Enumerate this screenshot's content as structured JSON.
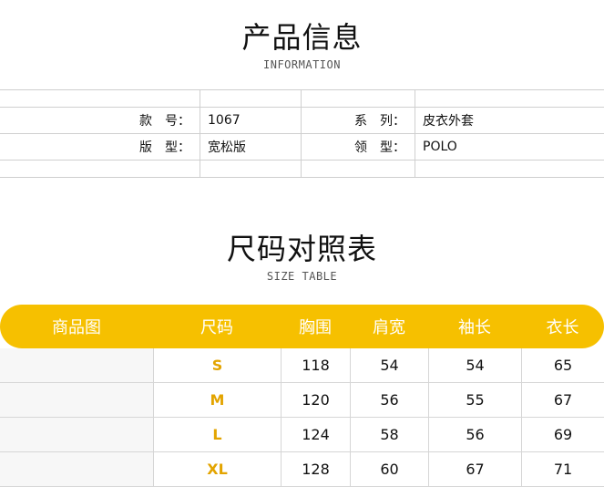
{
  "info": {
    "title": "产品信息",
    "subtitle": "INFORMATION",
    "rows": [
      {
        "l1": "款　号：",
        "v1": "1067",
        "l2": "系　列：",
        "v2": "皮衣外套"
      },
      {
        "l1": "版　型：",
        "v1": "宽松版",
        "l2": "领　型：",
        "v2": "POLO"
      }
    ]
  },
  "size_table": {
    "title": "尺码对照表",
    "subtitle": "SIZE TABLE",
    "headers": [
      "商品图",
      "尺码",
      "胸围",
      "肩宽",
      "袖长",
      "衣长"
    ],
    "rows": [
      {
        "size": "S",
        "chest": "118",
        "shoulder": "54",
        "sleeve": "54",
        "length": "65"
      },
      {
        "size": "M",
        "chest": "120",
        "shoulder": "56",
        "sleeve": "55",
        "length": "67"
      },
      {
        "size": "L",
        "chest": "124",
        "shoulder": "58",
        "sleeve": "56",
        "length": "69"
      },
      {
        "size": "XL",
        "chest": "128",
        "shoulder": "60",
        "sleeve": "67",
        "length": "71"
      }
    ],
    "header_color": "#f6c000",
    "size_color": "#e3a400"
  }
}
